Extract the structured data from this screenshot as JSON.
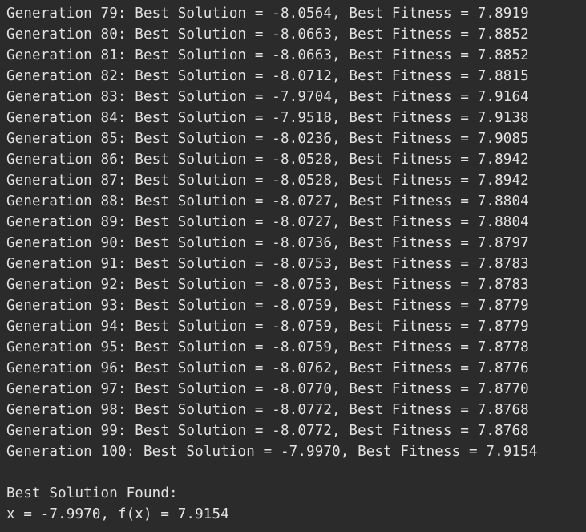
{
  "console": {
    "generations": [
      "Generation 79: Best Solution = -8.0564, Best Fitness = 7.8919",
      "Generation 80: Best Solution = -8.0663, Best Fitness = 7.8852",
      "Generation 81: Best Solution = -8.0663, Best Fitness = 7.8852",
      "Generation 82: Best Solution = -8.0712, Best Fitness = 7.8815",
      "Generation 83: Best Solution = -7.9704, Best Fitness = 7.9164",
      "Generation 84: Best Solution = -7.9518, Best Fitness = 7.9138",
      "Generation 85: Best Solution = -8.0236, Best Fitness = 7.9085",
      "Generation 86: Best Solution = -8.0528, Best Fitness = 7.8942",
      "Generation 87: Best Solution = -8.0528, Best Fitness = 7.8942",
      "Generation 88: Best Solution = -8.0727, Best Fitness = 7.8804",
      "Generation 89: Best Solution = -8.0727, Best Fitness = 7.8804",
      "Generation 90: Best Solution = -8.0736, Best Fitness = 7.8797",
      "Generation 91: Best Solution = -8.0753, Best Fitness = 7.8783",
      "Generation 92: Best Solution = -8.0753, Best Fitness = 7.8783",
      "Generation 93: Best Solution = -8.0759, Best Fitness = 7.8779",
      "Generation 94: Best Solution = -8.0759, Best Fitness = 7.8779",
      "Generation 95: Best Solution = -8.0759, Best Fitness = 7.8778",
      "Generation 96: Best Solution = -8.0762, Best Fitness = 7.8776",
      "Generation 97: Best Solution = -8.0770, Best Fitness = 7.8770",
      "Generation 98: Best Solution = -8.0772, Best Fitness = 7.8768",
      "Generation 99: Best Solution = -8.0772, Best Fitness = 7.8768",
      "Generation 100: Best Solution = -7.9970, Best Fitness = 7.9154"
    ],
    "summary_header": "Best Solution Found:",
    "summary_result": "x = -7.9970, f(x) = 7.9154"
  },
  "colors": {
    "background": "#2b2b2b",
    "text": "#e2e2e2"
  }
}
